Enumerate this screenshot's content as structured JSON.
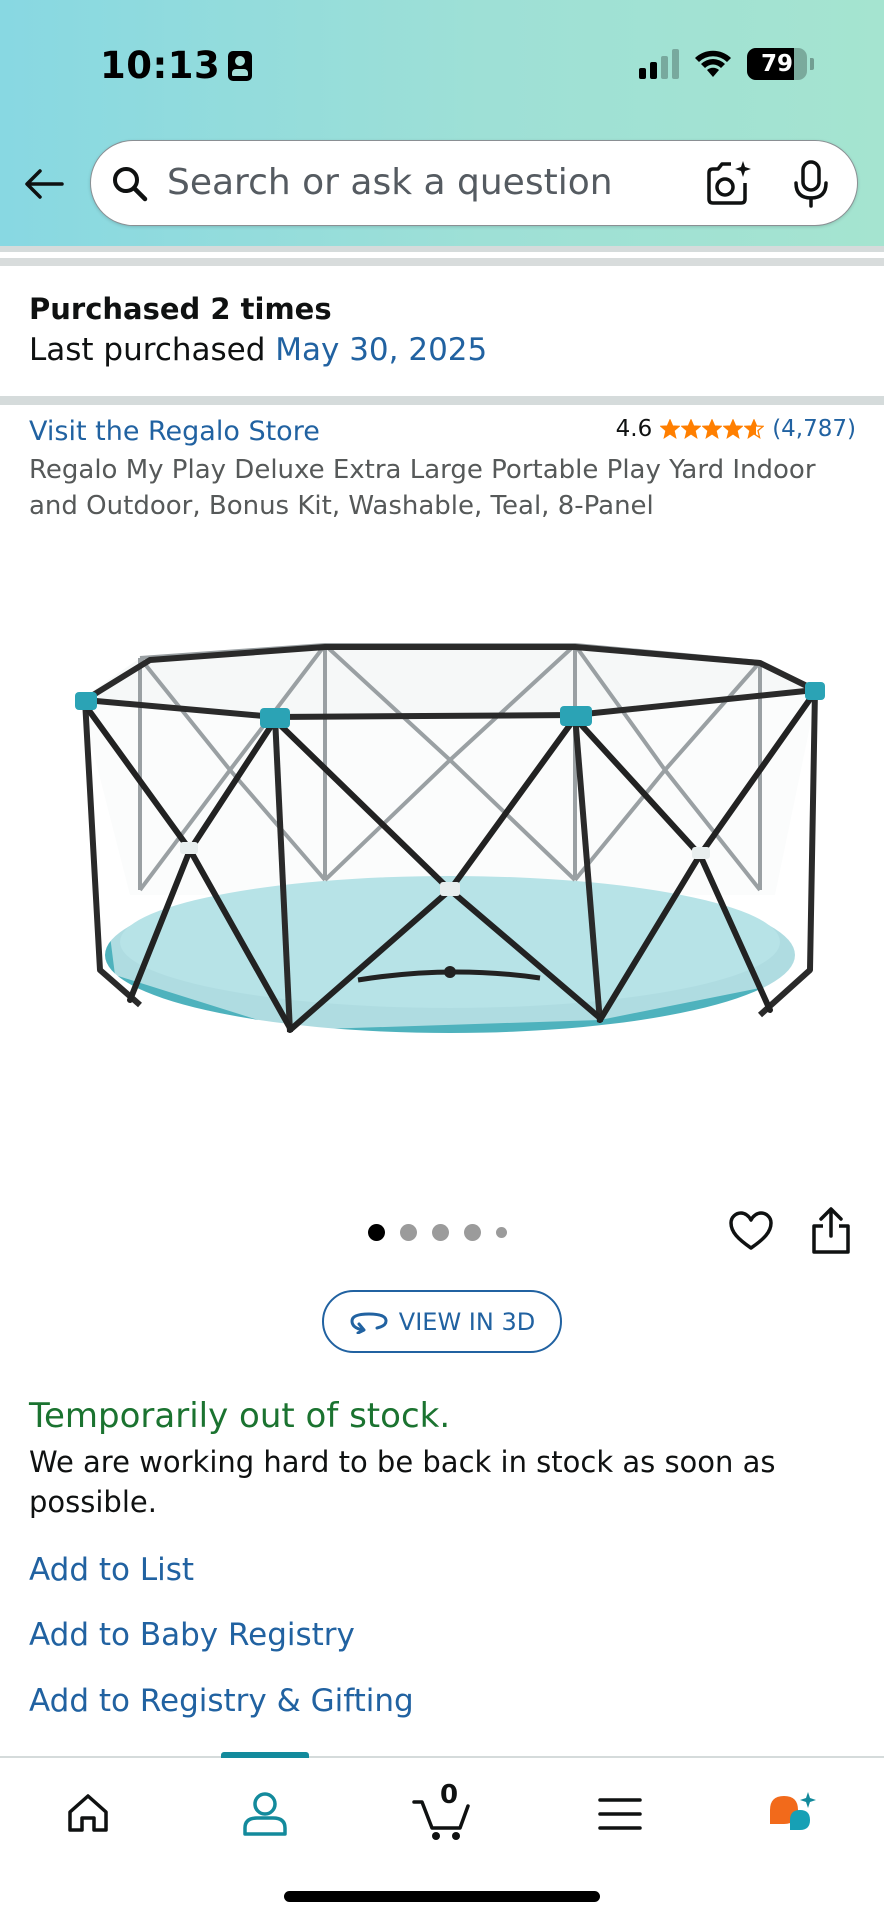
{
  "status_bar": {
    "time": "10:13",
    "battery_percent": "79",
    "battery_level": 0.79,
    "signal_bars_active": 2,
    "signal_bars_total": 4
  },
  "search": {
    "placeholder": "Search or ask a question"
  },
  "purchase_history": {
    "title": "Purchased 2 times",
    "last_purchased_prefix": "Last purchased",
    "last_purchased_date": "May 30, 2025"
  },
  "product": {
    "store_link": "Visit the Regalo Store",
    "rating": "4.6",
    "rating_value": 4.6,
    "review_count": "(4,787)",
    "title": "Regalo My Play Deluxe Extra Large Portable Play Yard Indoor and Outdoor, Bonus Kit, Washable, Teal, 8-Panel",
    "image_count": 5,
    "active_image_index": 0
  },
  "view_3d_label": "VIEW IN 3D",
  "availability": {
    "status": "Temporarily out of stock.",
    "description": "We are working hard to be back in stock as soon as possible."
  },
  "actions": {
    "add_to_list": "Add to List",
    "add_to_baby_registry": "Add to Baby Registry",
    "add_to_registry_gifting": "Add to Registry & Gifting"
  },
  "bottom_nav": {
    "cart_count": "0",
    "active_tab": "account",
    "items": [
      "home-icon",
      "account-icon",
      "cart-icon",
      "menu-icon",
      "rufus-ai-icon"
    ]
  },
  "colors": {
    "link": "#2162a1",
    "in_stock_status": "#1b7330",
    "star": "#ff7f00",
    "nav_active": "#138a9c",
    "header_gradient_start": "#88d8e2",
    "header_gradient_end": "#a5e4d0"
  }
}
